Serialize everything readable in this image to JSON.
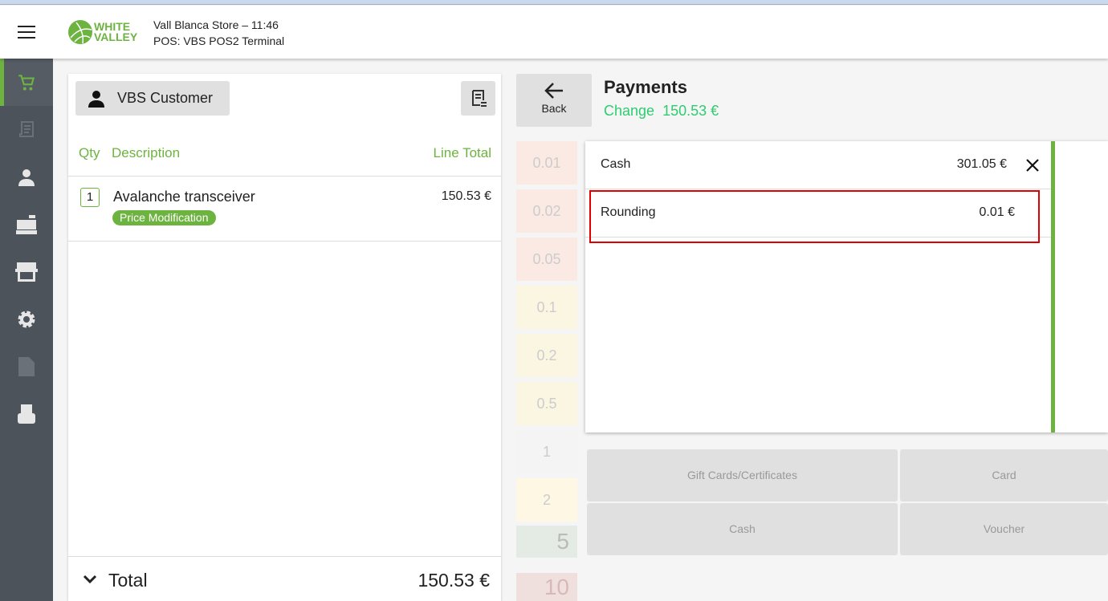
{
  "header": {
    "store_line": "Vall Blanca Store – 11:46",
    "pos_line": "POS: VBS POS2 Terminal",
    "logo_text": [
      "WHITE",
      "VALLEY"
    ]
  },
  "sidebar": {
    "items": [
      "cart",
      "tickets",
      "customers",
      "cash-register",
      "store",
      "settings",
      "documents",
      "terminal"
    ]
  },
  "cart": {
    "customer": "VBS Customer",
    "columns": {
      "qty": "Qty",
      "description": "Description",
      "line_total": "Line Total"
    },
    "lines": [
      {
        "qty": "1",
        "description": "Avalanche transceiver",
        "badge": "Price Modification",
        "total": "150.53 €"
      }
    ],
    "total_label": "Total",
    "total_value": "150.53 €"
  },
  "payments": {
    "back_label": "Back",
    "title": "Payments",
    "change_label": "Change",
    "change_value": "150.53 €",
    "coins": [
      "0.01",
      "0.02",
      "0.05",
      "0.1",
      "0.2",
      "0.5",
      "1",
      "2",
      "5",
      "10"
    ],
    "rows": [
      {
        "name": "Cash",
        "amount": "301.05 €"
      },
      {
        "name": "Rounding",
        "amount": "0.01 €"
      }
    ],
    "methods": [
      "Gift Cards/Certificates",
      "Card",
      "Cash",
      "Voucher"
    ]
  },
  "colors": {
    "accent": "#6db33f",
    "change": "#2ecc71",
    "highlight": "#e00000"
  }
}
